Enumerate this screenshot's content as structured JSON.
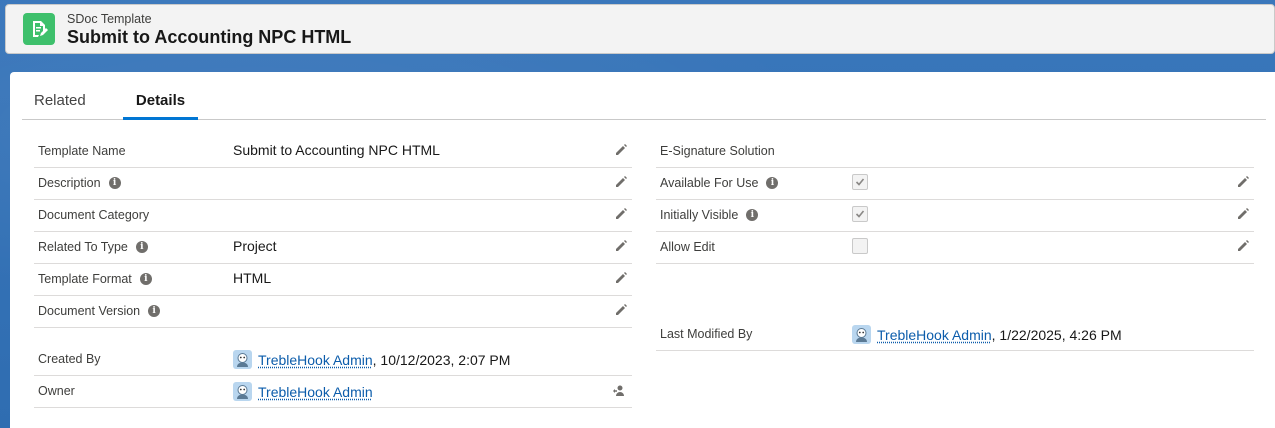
{
  "header": {
    "eyebrow": "SDoc Template",
    "title": "Submit to Accounting NPC HTML",
    "icon": "document-edit-icon",
    "icon_color": "#3ec06c"
  },
  "tabs": [
    {
      "label": "Related",
      "active": false
    },
    {
      "label": "Details",
      "active": true
    }
  ],
  "left_fields": {
    "template_name": {
      "label": "Template Name",
      "value": "Submit to Accounting NPC HTML"
    },
    "description": {
      "label": "Description",
      "value": ""
    },
    "document_category": {
      "label": "Document Category",
      "value": ""
    },
    "related_to_type": {
      "label": "Related To Type",
      "value": "Project"
    },
    "template_format": {
      "label": "Template Format",
      "value": "HTML"
    },
    "document_version": {
      "label": "Document Version",
      "value": ""
    }
  },
  "right_fields": {
    "esignature_solution": {
      "label": "E-Signature Solution",
      "value": ""
    },
    "available_for_use": {
      "label": "Available For Use",
      "checked": true
    },
    "initially_visible": {
      "label": "Initially Visible",
      "checked": true
    },
    "allow_edit": {
      "label": "Allow Edit",
      "checked": false
    }
  },
  "system": {
    "created_by": {
      "label": "Created By",
      "user": "TrebleHook Admin",
      "date": ", 10/12/2023, 2:07 PM"
    },
    "owner": {
      "label": "Owner",
      "user": "TrebleHook Admin"
    },
    "last_modified_by": {
      "label": "Last Modified By",
      "user": "TrebleHook Admin",
      "date": ", 1/22/2025, 4:26 PM"
    }
  },
  "colors": {
    "accent": "#0176d3",
    "link": "#0b5cab"
  }
}
